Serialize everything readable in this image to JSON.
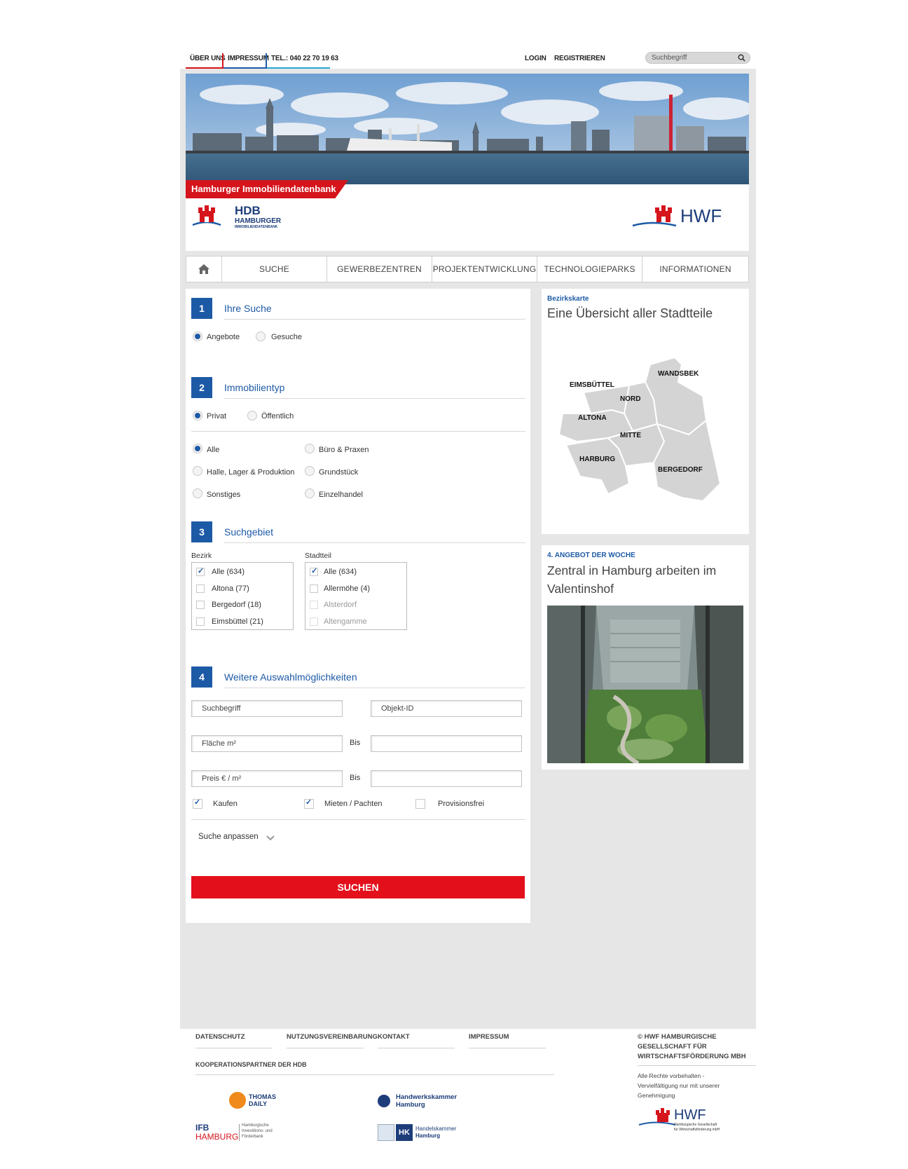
{
  "topbar": {
    "about": "ÜBER UNS",
    "imprint": "IMPRESSUM",
    "phone": "TEL.: 040 22 70 19 63",
    "login": "LOGIN",
    "register": "REGISTRIEREN",
    "search_placeholder": "Suchbegriff"
  },
  "header": {
    "ribbon": "Hamburger Immobiliendatenbank",
    "hdb_logo_big": "HDB",
    "hdb_logo_line1": "HAMBURGER",
    "hdb_logo_line2": "IMMOBILIENDATENBANK",
    "hwf_logo": "HWF"
  },
  "nav": [
    "SUCHE",
    "GEWERBEZENTREN",
    "PROJEKTENTWICKLUNG",
    "TECHNOLOGIEPARKS",
    "INFORMATIONEN"
  ],
  "step1": {
    "num": "1",
    "title": "Ihre Suche",
    "options": [
      "Angebote",
      "Gesuche"
    ]
  },
  "step2": {
    "num": "2",
    "title": "Immobilientyp",
    "scope": [
      "Privat",
      "Öffentlich"
    ],
    "types": [
      "Alle",
      "Büro & Praxen",
      "Halle, Lager & Produktion",
      "Grundstück",
      "Sonstiges",
      "Einzelhandel"
    ]
  },
  "step3": {
    "num": "3",
    "title": "Suchgebiet",
    "bezirk_label": "Bezirk",
    "stadtteil_label": "Stadtteil",
    "bezirk": [
      "Alle (634)",
      "Altona (77)",
      "Bergedorf (18)",
      "Eimsbüttel (21)"
    ],
    "stadtteil": [
      "Alle (634)",
      "Allermöhe (4)",
      "Alsterdorf",
      "Altengamme"
    ]
  },
  "step4": {
    "num": "4",
    "title": "Weitere Auswahlmöglichkeiten",
    "search_term": "Suchbegriff",
    "object_id": "Objekt-ID",
    "area": "Fläche m²",
    "price": "Preis € / m²",
    "bis": "Bis",
    "buy": "Kaufen",
    "rent": "Mieten / Pachten",
    "no_commission": "Provisionsfrei",
    "refine": "Suche anpassen",
    "submit": "SUCHEN"
  },
  "map": {
    "kicker": "Bezirkskarte",
    "title": "Eine Übersicht aller Stadtteile",
    "districts": [
      "EIMSBÜTTEL",
      "WANDSBEK",
      "NORD",
      "ALTONA",
      "MITTE",
      "HARBURG",
      "BERGEDORF"
    ]
  },
  "offer": {
    "kicker": "4. ANGEBOT DER WOCHE",
    "title_line1": "Zentral in Hamburg arbeiten im",
    "title_line2": "Valentinshof"
  },
  "footer": {
    "links": [
      "DATENSCHUTZ",
      "NUTZUNGSVEREINBARUNG",
      "KONTAKT",
      "IMPRESSUM"
    ],
    "partners_title": "KOOPERATIONSPARTNER DER HDB",
    "copyright_1": "© HWF HAMBURGISCHE",
    "copyright_2": "GESELLSCHAFT FÜR",
    "copyright_3": "WIRTSCHAFTSFÖRDERUNG MBH",
    "rights_1": "Alle Rechte vorbehalten -",
    "rights_2": "Vervielfältigung nur mit unserer",
    "rights_3": "Genehmigung",
    "partner_thomas_1": "THOMAS",
    "partner_thomas_2": "DAILY",
    "partner_hwk_1": "Handwerkskammer",
    "partner_hwk_2": "Hamburg",
    "partner_ifb_1": "IFB",
    "partner_ifb_2": "HAMBURG",
    "partner_ifb_3": "Hamburgische",
    "partner_ifb_4": "Investitions- und",
    "partner_ifb_5": "Förderbank",
    "partner_hk_abbr": "HK",
    "partner_hk_1": "Handelskammer",
    "partner_hk_2": "Hamburg",
    "hwf_footer": "HWF",
    "hwf_footer_sub1": "Hamburgische Gesellschaft",
    "hwf_footer_sub2": "für Wirtschaftsförderung mbH"
  },
  "colors": {
    "brand_blue": "#1d5aa6",
    "brand_red": "#e3101b",
    "frame_gray": "#e6e6e6"
  }
}
